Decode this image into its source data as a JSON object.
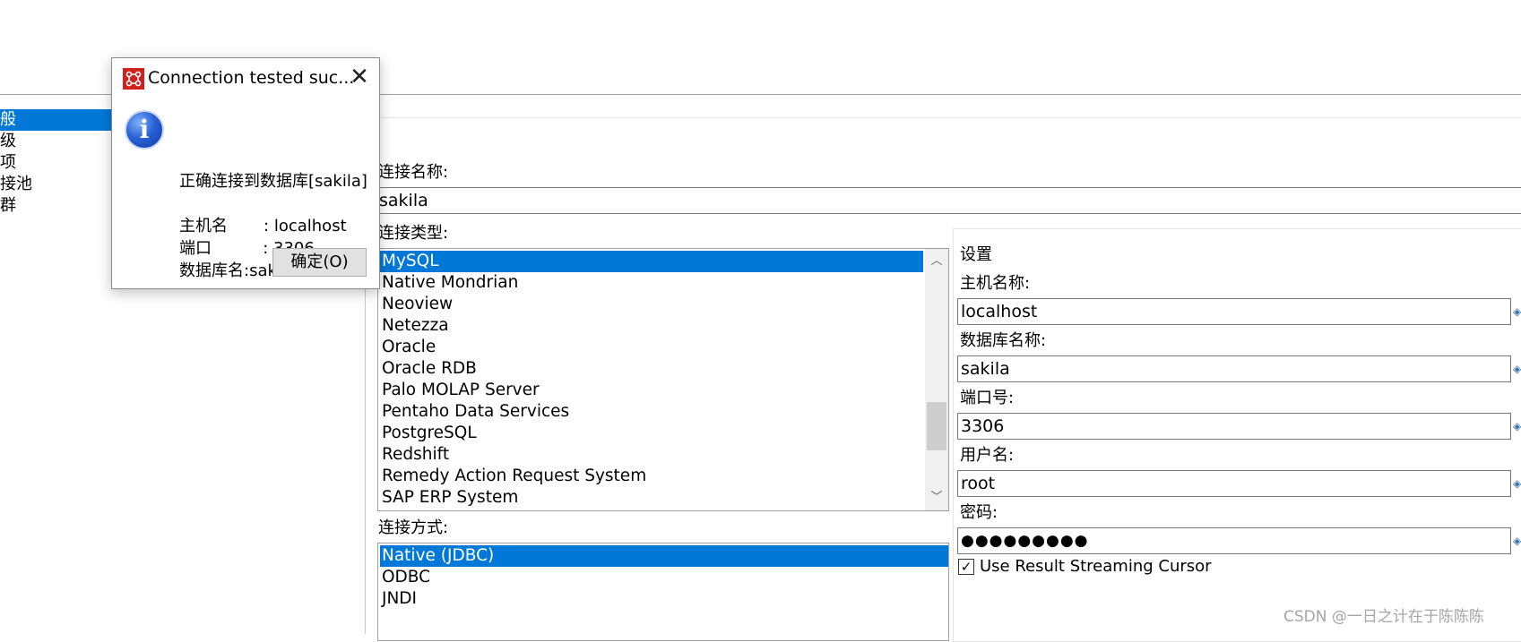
{
  "nav": {
    "items": [
      {
        "label": "般",
        "selected": true
      },
      {
        "label": "级",
        "selected": false
      },
      {
        "label": "项",
        "selected": false
      },
      {
        "label": "接池",
        "selected": false
      },
      {
        "label": "群",
        "selected": false
      }
    ]
  },
  "connection": {
    "name_label": "连接名称:",
    "name_value": "sakila",
    "type_label": "连接类型:",
    "types": [
      {
        "label": "MySQL",
        "selected": true
      },
      {
        "label": "Native Mondrian",
        "selected": false
      },
      {
        "label": "Neoview",
        "selected": false
      },
      {
        "label": "Netezza",
        "selected": false
      },
      {
        "label": "Oracle",
        "selected": false
      },
      {
        "label": "Oracle RDB",
        "selected": false
      },
      {
        "label": "Palo MOLAP Server",
        "selected": false
      },
      {
        "label": "Pentaho Data Services",
        "selected": false
      },
      {
        "label": "PostgreSQL",
        "selected": false
      },
      {
        "label": "Redshift",
        "selected": false
      },
      {
        "label": "Remedy Action Request System",
        "selected": false
      },
      {
        "label": "SAP ERP System",
        "selected": false
      }
    ],
    "method_label": "连接方式:",
    "methods": [
      {
        "label": "Native (JDBC)",
        "selected": true
      },
      {
        "label": "ODBC",
        "selected": false
      },
      {
        "label": "JNDI",
        "selected": false
      }
    ]
  },
  "settings": {
    "title": "设置",
    "host_label": "主机名称:",
    "host_value": "localhost",
    "db_label": "数据库名称:",
    "db_value": "sakila",
    "port_label": "端口号:",
    "port_value": "3306",
    "user_label": "用户名:",
    "user_value": "root",
    "password_label": "密码:",
    "password_value": "●●●●●●●●●",
    "streaming_label": "Use Result Streaming Cursor",
    "streaming_checked": "✓",
    "var_icon": "◈"
  },
  "dialog": {
    "title": "Connection tested suc...",
    "close_glyph": "✕",
    "info_glyph": "i",
    "message": "正确连接到数据库[sakila]",
    "host_line": "主机名       : localhost",
    "port_line": "端口          : 3306",
    "db_line": "数据库名:sakila",
    "ok_label": "确定(O)"
  },
  "scroll": {
    "up": "︿",
    "down": "﹀"
  },
  "watermark": "CSDN @一日之计在于陈陈陈"
}
